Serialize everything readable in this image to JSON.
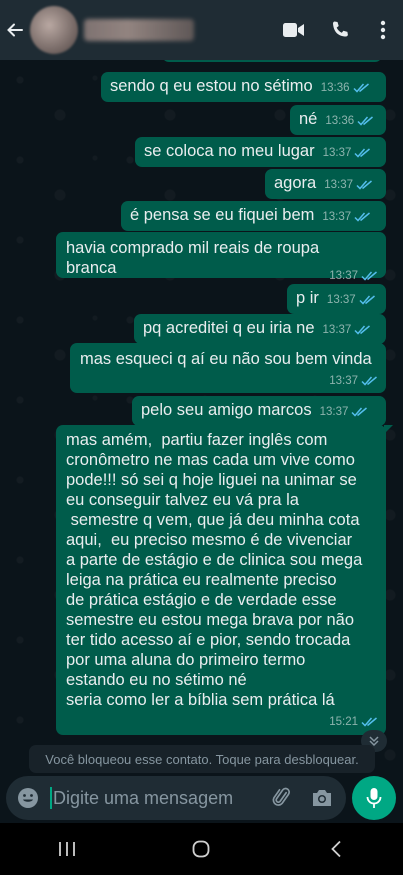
{
  "header": {
    "back_icon": "arrow-left-icon",
    "video_icon": "video-camera-icon",
    "call_icon": "phone-icon",
    "menu_icon": "more-vertical-icon"
  },
  "colors": {
    "outgoing_bubble": "#005c4b",
    "header_bg": "#1f2c34",
    "read_tick": "#53bdeb",
    "accent": "#00a884"
  },
  "messages": [
    {
      "text": "sendo q eu estou no sétimo",
      "time": "13:36"
    },
    {
      "text": "né",
      "time": "13:36"
    },
    {
      "text": "se coloca no meu lugar",
      "time": "13:37"
    },
    {
      "text": "agora",
      "time": "13:37"
    },
    {
      "text": "é pensa se eu fiquei bem",
      "time": "13:37"
    },
    {
      "text": "havia comprado mil reais de roupa\nbranca",
      "time": "13:37"
    },
    {
      "text": "p ir",
      "time": "13:37"
    },
    {
      "text": "pq acreditei q eu iria ne",
      "time": "13:37"
    },
    {
      "text": "mas esqueci q aí eu não sou bem vinda",
      "time": "13:37"
    },
    {
      "text": "pelo seu amigo marcos",
      "time": "13:37"
    },
    {
      "text": "mas amém,  partiu fazer inglês com\ncronômetro ne mas cada um vive como\npode!!! só sei q hoje liguei na unimar se\neu conseguir talvez eu vá pra la\n semestre q vem, que já deu minha cota\naqui,  eu preciso mesmo é de vivenciar\na parte de estágio e de clinica sou mega\nleiga na prática eu realmente preciso\nde prática estágio e de verdade esse\nsemestre eu estou mega brava por não\nter tido acesso aí e pior, sendo trocada\npor uma aluna do primeiro termo\nestando eu no sétimo né\nseria como ler a bíblia sem prática lá",
      "time": "15:21"
    }
  ],
  "system_message": "Você bloqueou esse contato. Toque para desbloquear.",
  "input": {
    "placeholder": "Digite uma mensagem",
    "emoji_icon": "emoji-icon",
    "attach_icon": "paperclip-icon",
    "camera_icon": "camera-icon",
    "mic_icon": "microphone-icon"
  },
  "navbar": {
    "recents_icon": "recents-icon",
    "home_icon": "home-icon",
    "back_icon": "back-chevron-icon"
  }
}
